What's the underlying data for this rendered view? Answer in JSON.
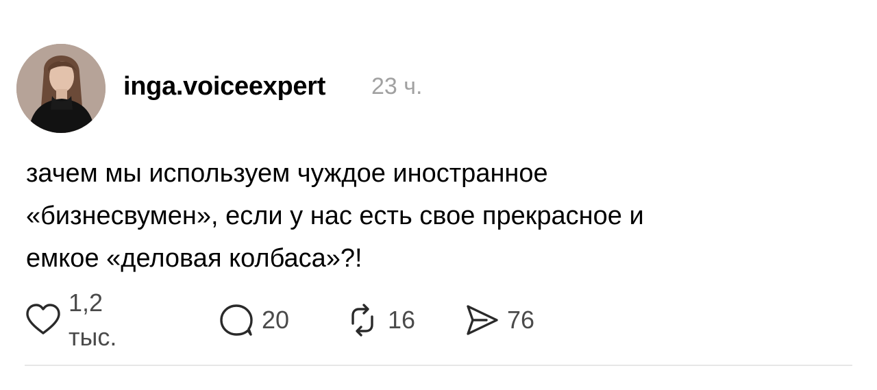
{
  "post": {
    "author": {
      "username": "inga.voiceexpert",
      "avatar_icon": "user-avatar-photo"
    },
    "timestamp": "23 ч.",
    "text": "зачем мы используем чуждое иностранное\n«бизнесвумен», если у нас есть свое прекрасное и\nемкое «деловая колбаса»?!",
    "actions": {
      "like": {
        "icon": "heart-icon",
        "count": "1,2 тыс."
      },
      "reply": {
        "icon": "comment-bubble-icon",
        "count": "20"
      },
      "repost": {
        "icon": "repost-arrows-icon",
        "count": "16"
      },
      "share": {
        "icon": "send-icon",
        "count": "76"
      }
    }
  },
  "colors": {
    "text": "#000000",
    "muted": "#a1a1a1",
    "count": "#4a4a4a",
    "divider": "#e6e6e6"
  }
}
